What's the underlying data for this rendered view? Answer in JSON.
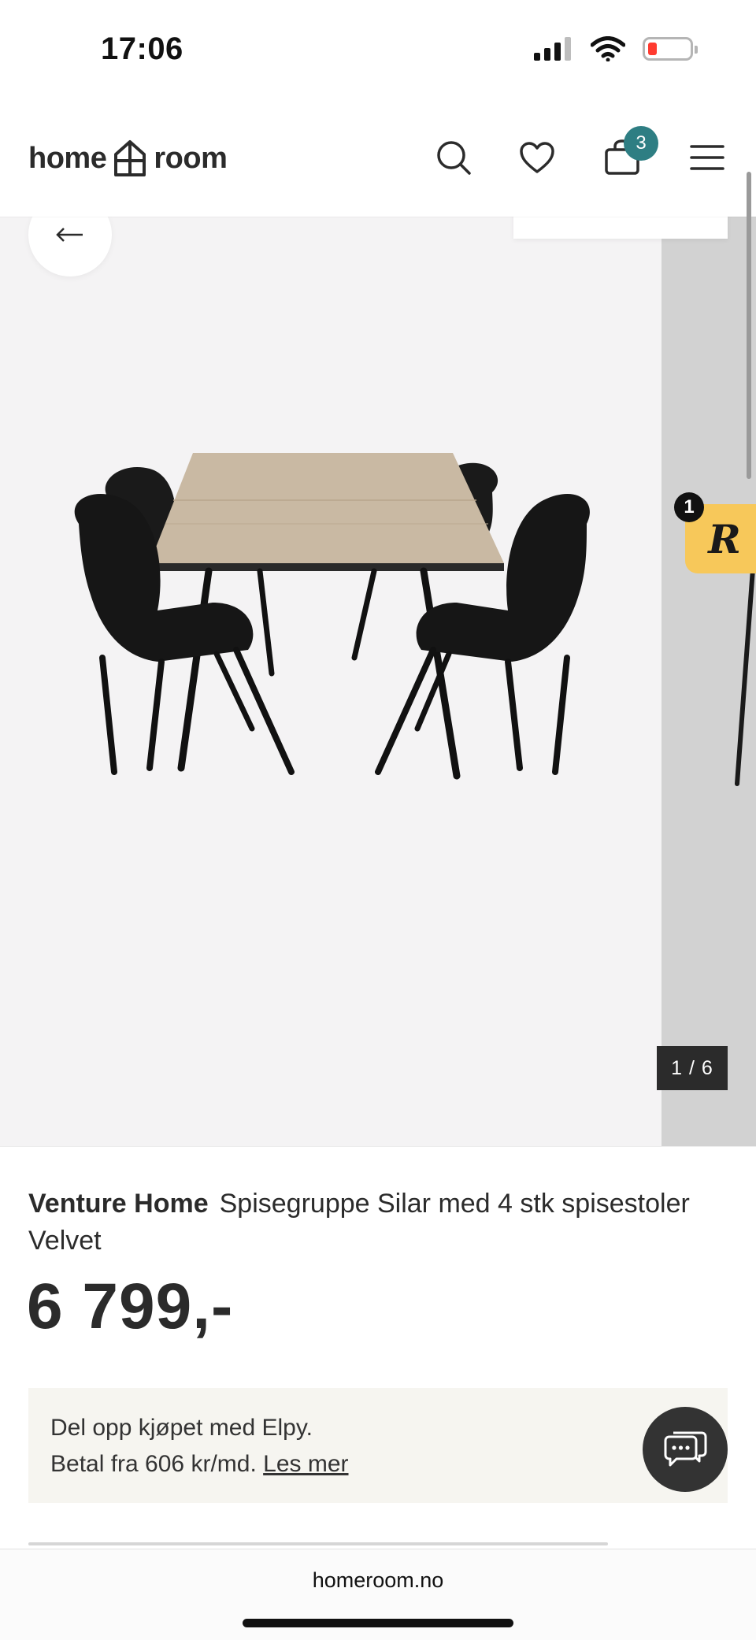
{
  "status_bar": {
    "time": "17:06",
    "icons": [
      "cellular-signal-icon",
      "wifi-icon",
      "battery-low-icon"
    ]
  },
  "header": {
    "logo_left": "home",
    "logo_right": "room",
    "icons": [
      "search-icon",
      "heart-icon",
      "shopping-bag-icon",
      "hamburger-menu-icon"
    ],
    "cart_count": "3"
  },
  "gallery": {
    "counter": "1 / 6",
    "reviews_badge_letter": "R",
    "reviews_badge_count": "1",
    "colors": {
      "background": "#f4f3f4",
      "next_slide": "#d2d2d2",
      "wood": "#c9b9a3",
      "chair": "#1a1a1a"
    }
  },
  "product": {
    "brand": "Venture Home",
    "name": "Spisegruppe Silar med 4 stk spisestoler Velvet",
    "price": "6 799,-"
  },
  "financing": {
    "line1": "Del opp kjøpet med Elpy.",
    "line2_prefix": "Betal fra 606 kr/md.",
    "link_label": "Les mer"
  },
  "browser": {
    "url": "homeroom.no"
  },
  "colors": {
    "accent": "#2e7e83",
    "text": "#2b2b2b",
    "financing_bg": "#f6f5f0",
    "chat_button": "#333333"
  }
}
